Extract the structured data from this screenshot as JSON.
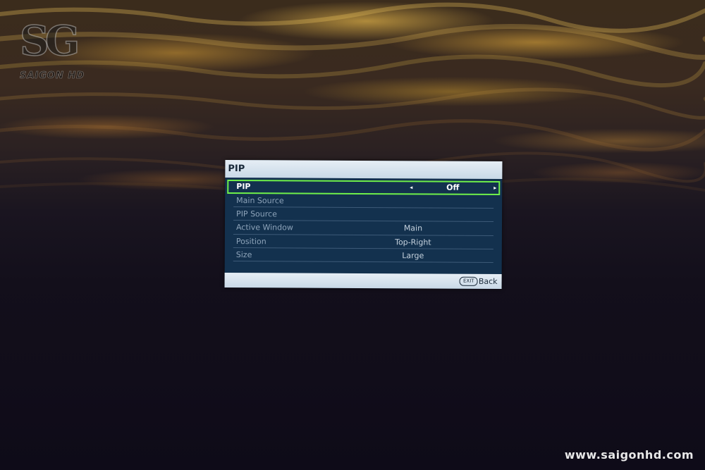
{
  "watermark": {
    "logo_letters": "SG",
    "logo_text": "SAIGON HD",
    "url": "www.saigonhd.com"
  },
  "osd": {
    "title": "PIP",
    "rows": [
      {
        "label": "PIP",
        "value": "Off",
        "selected": true,
        "enabled": true
      },
      {
        "label": "Main Source",
        "value": "",
        "selected": false,
        "enabled": false
      },
      {
        "label": "PIP Source",
        "value": "",
        "selected": false,
        "enabled": false
      },
      {
        "label": "Active Window",
        "value": "Main",
        "selected": false,
        "enabled": false
      },
      {
        "label": "Position",
        "value": "Top-Right",
        "selected": false,
        "enabled": false
      },
      {
        "label": "Size",
        "value": "Large",
        "selected": false,
        "enabled": false
      }
    ],
    "footer": {
      "exit_badge": "EXIT",
      "back_label": "Back"
    },
    "arrows": {
      "left": "◂",
      "right": "▸"
    },
    "colors": {
      "panel": "#13314e",
      "header": "#dfe9f2",
      "selection": "#6ff04a"
    }
  }
}
